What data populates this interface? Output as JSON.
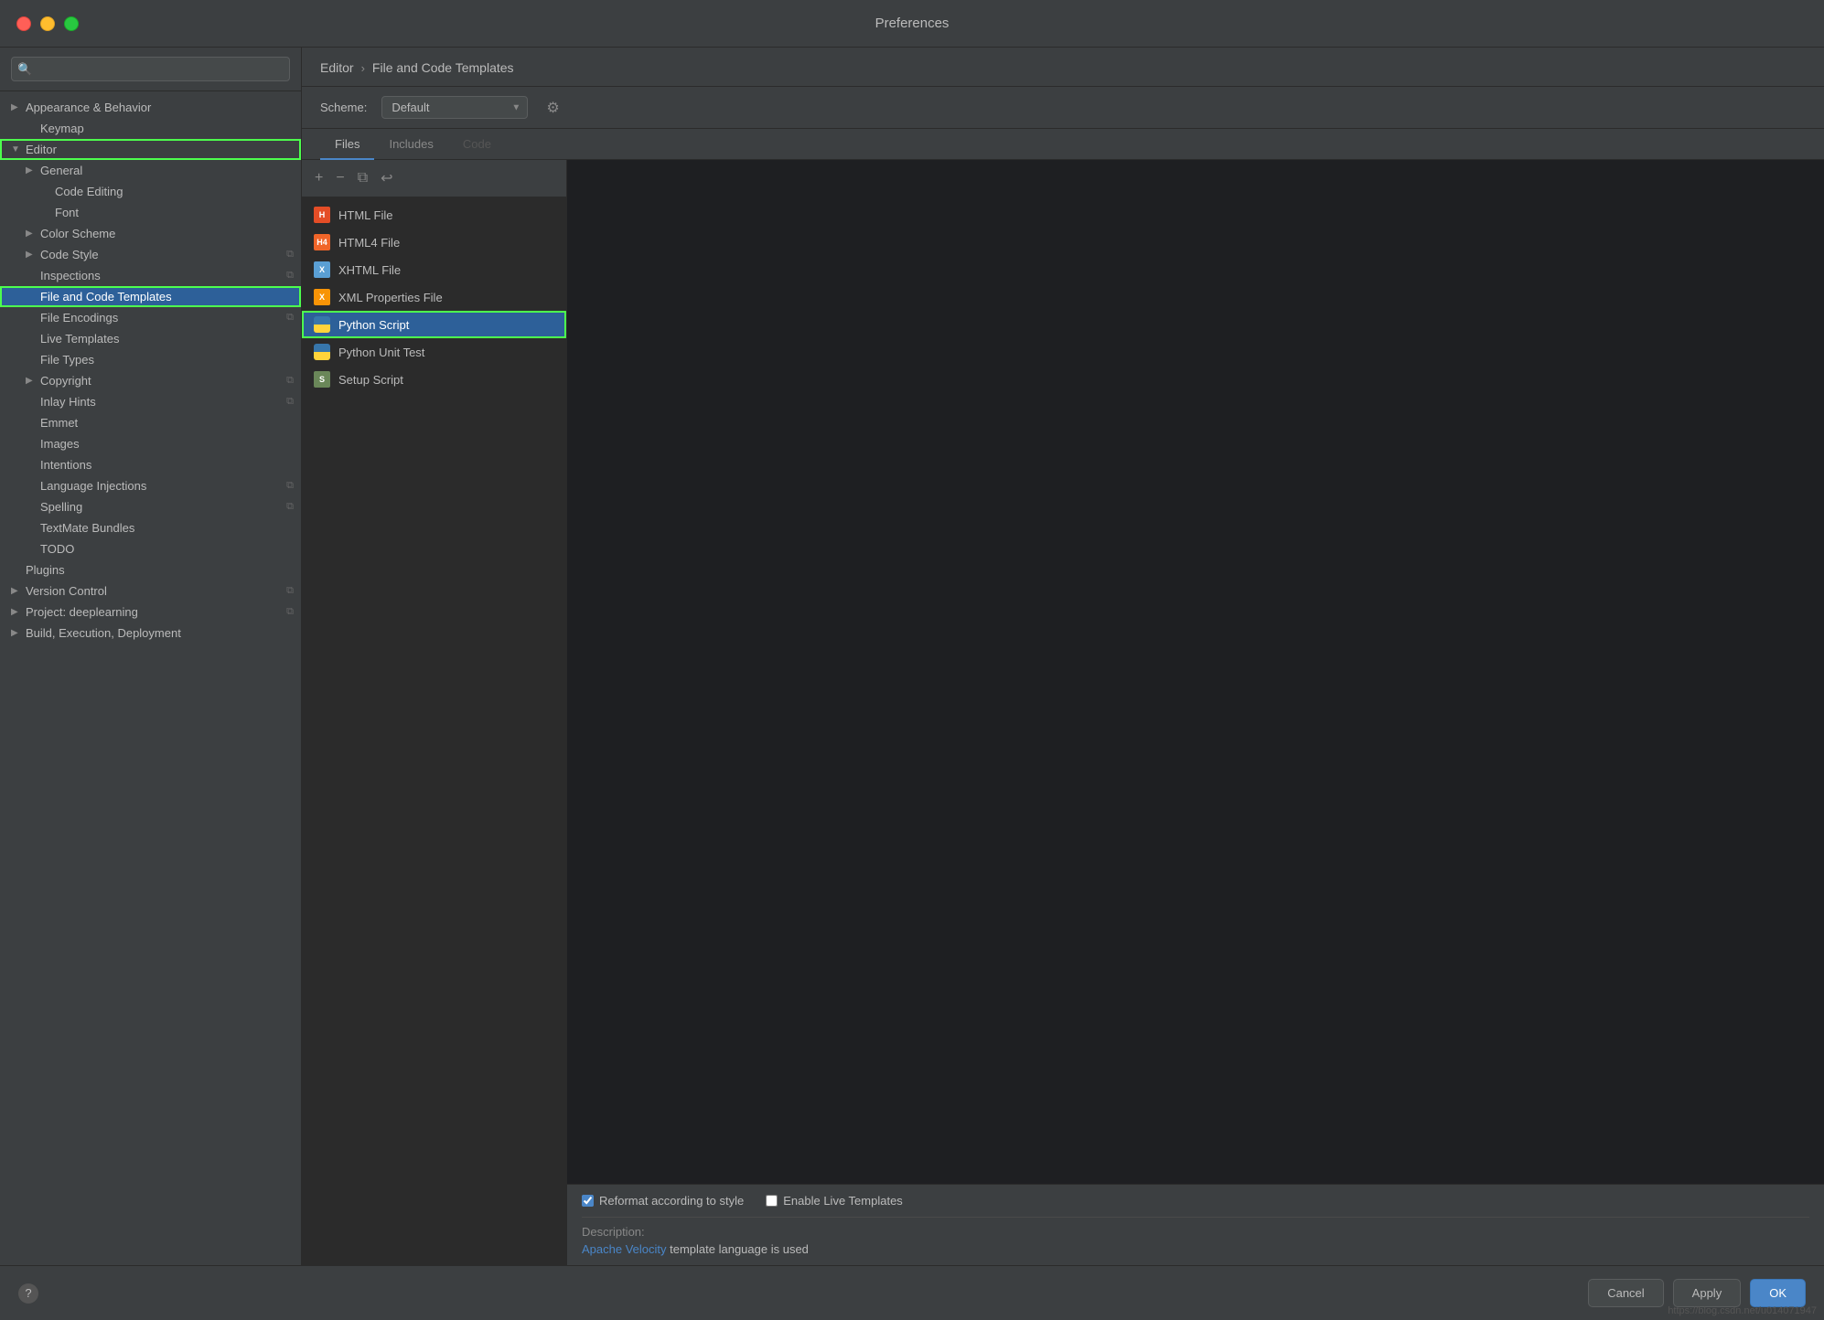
{
  "window": {
    "title": "Preferences"
  },
  "sidebar": {
    "search_placeholder": "🔍",
    "items": [
      {
        "id": "appearance-behavior",
        "label": "Appearance & Behavior",
        "level": 0,
        "expanded": true,
        "hasArrow": true,
        "indent": "indent1"
      },
      {
        "id": "keymap",
        "label": "Keymap",
        "level": 1,
        "indent": "indent1"
      },
      {
        "id": "editor",
        "label": "Editor",
        "level": 0,
        "expanded": true,
        "hasArrow": true,
        "selected": false,
        "outlined": true,
        "indent": "indent1"
      },
      {
        "id": "general",
        "label": "General",
        "level": 1,
        "hasArrow": true,
        "indent": "indent2"
      },
      {
        "id": "code-editing",
        "label": "Code Editing",
        "level": 2,
        "indent": "indent3"
      },
      {
        "id": "font",
        "label": "Font",
        "level": 2,
        "indent": "indent3"
      },
      {
        "id": "color-scheme",
        "label": "Color Scheme",
        "level": 1,
        "hasArrow": true,
        "indent": "indent2"
      },
      {
        "id": "code-style",
        "label": "Code Style",
        "level": 1,
        "hasArrow": true,
        "hasCopy": true,
        "indent": "indent2"
      },
      {
        "id": "inspections",
        "label": "Inspections",
        "level": 2,
        "hasCopy": true,
        "indent": "indent2"
      },
      {
        "id": "file-and-code-templates",
        "label": "File and Code Templates",
        "level": 2,
        "selected": true,
        "indent": "indent2"
      },
      {
        "id": "file-encodings",
        "label": "File Encodings",
        "level": 2,
        "hasCopy": true,
        "indent": "indent2"
      },
      {
        "id": "live-templates",
        "label": "Live Templates",
        "level": 2,
        "indent": "indent2"
      },
      {
        "id": "file-types",
        "label": "File Types",
        "level": 2,
        "indent": "indent2"
      },
      {
        "id": "copyright",
        "label": "Copyright",
        "level": 1,
        "hasArrow": true,
        "hasCopy": true,
        "indent": "indent2"
      },
      {
        "id": "inlay-hints",
        "label": "Inlay Hints",
        "level": 2,
        "hasCopy": true,
        "indent": "indent2"
      },
      {
        "id": "emmet",
        "label": "Emmet",
        "level": 2,
        "indent": "indent2"
      },
      {
        "id": "images",
        "label": "Images",
        "level": 2,
        "indent": "indent2"
      },
      {
        "id": "intentions",
        "label": "Intentions",
        "level": 2,
        "indent": "indent2"
      },
      {
        "id": "language-injections",
        "label": "Language Injections",
        "level": 2,
        "hasCopy": true,
        "indent": "indent2"
      },
      {
        "id": "spelling",
        "label": "Spelling",
        "level": 2,
        "hasCopy": true,
        "indent": "indent2"
      },
      {
        "id": "textmate-bundles",
        "label": "TextMate Bundles",
        "level": 2,
        "indent": "indent2"
      },
      {
        "id": "todo",
        "label": "TODO",
        "level": 2,
        "indent": "indent2"
      },
      {
        "id": "plugins",
        "label": "Plugins",
        "level": 0,
        "indent": "indent1"
      },
      {
        "id": "version-control",
        "label": "Version Control",
        "level": 0,
        "hasArrow": true,
        "hasCopy": true,
        "indent": "indent1"
      },
      {
        "id": "project-deeplearning",
        "label": "Project: deeplearning",
        "level": 0,
        "hasArrow": true,
        "hasCopy": true,
        "indent": "indent1"
      },
      {
        "id": "build-execution",
        "label": "Build, Execution, Deployment",
        "level": 0,
        "hasArrow": true,
        "indent": "indent1"
      }
    ]
  },
  "main": {
    "breadcrumb": {
      "parent": "Editor",
      "separator": "›",
      "current": "File and Code Templates"
    },
    "scheme": {
      "label": "Scheme:",
      "value": "Default"
    },
    "tabs": [
      {
        "id": "files",
        "label": "Files",
        "active": true
      },
      {
        "id": "includes",
        "label": "Includes",
        "active": false
      },
      {
        "id": "code",
        "label": "Code",
        "active": false,
        "dimmed": true
      }
    ],
    "toolbar": {
      "add": "+",
      "remove": "−",
      "copy": "⧉",
      "reset": "↩"
    },
    "files": [
      {
        "id": "html-file",
        "label": "HTML File",
        "icon": "html"
      },
      {
        "id": "html4-file",
        "label": "HTML4 File",
        "icon": "html4"
      },
      {
        "id": "xhtml-file",
        "label": "XHTML File",
        "icon": "xhtml"
      },
      {
        "id": "xml-properties-file",
        "label": "XML Properties File",
        "icon": "xml"
      },
      {
        "id": "python-script",
        "label": "Python Script",
        "icon": "python",
        "selected": true,
        "outlined": true
      },
      {
        "id": "python-unit-test",
        "label": "Python Unit Test",
        "icon": "python"
      },
      {
        "id": "setup-script",
        "label": "Setup Script",
        "icon": "setup"
      }
    ],
    "editor": {
      "reformat_label": "Reformat according to style",
      "live_templates_label": "Enable Live Templates",
      "description_label": "Description:",
      "description_velocity_text": "Apache Velocity",
      "description_rest_text": " template language is used"
    }
  },
  "footer": {
    "help_icon": "?",
    "cancel_label": "Cancel",
    "apply_label": "Apply",
    "ok_label": "OK"
  },
  "watermark": "https://blog.csdn.net/u014071947"
}
